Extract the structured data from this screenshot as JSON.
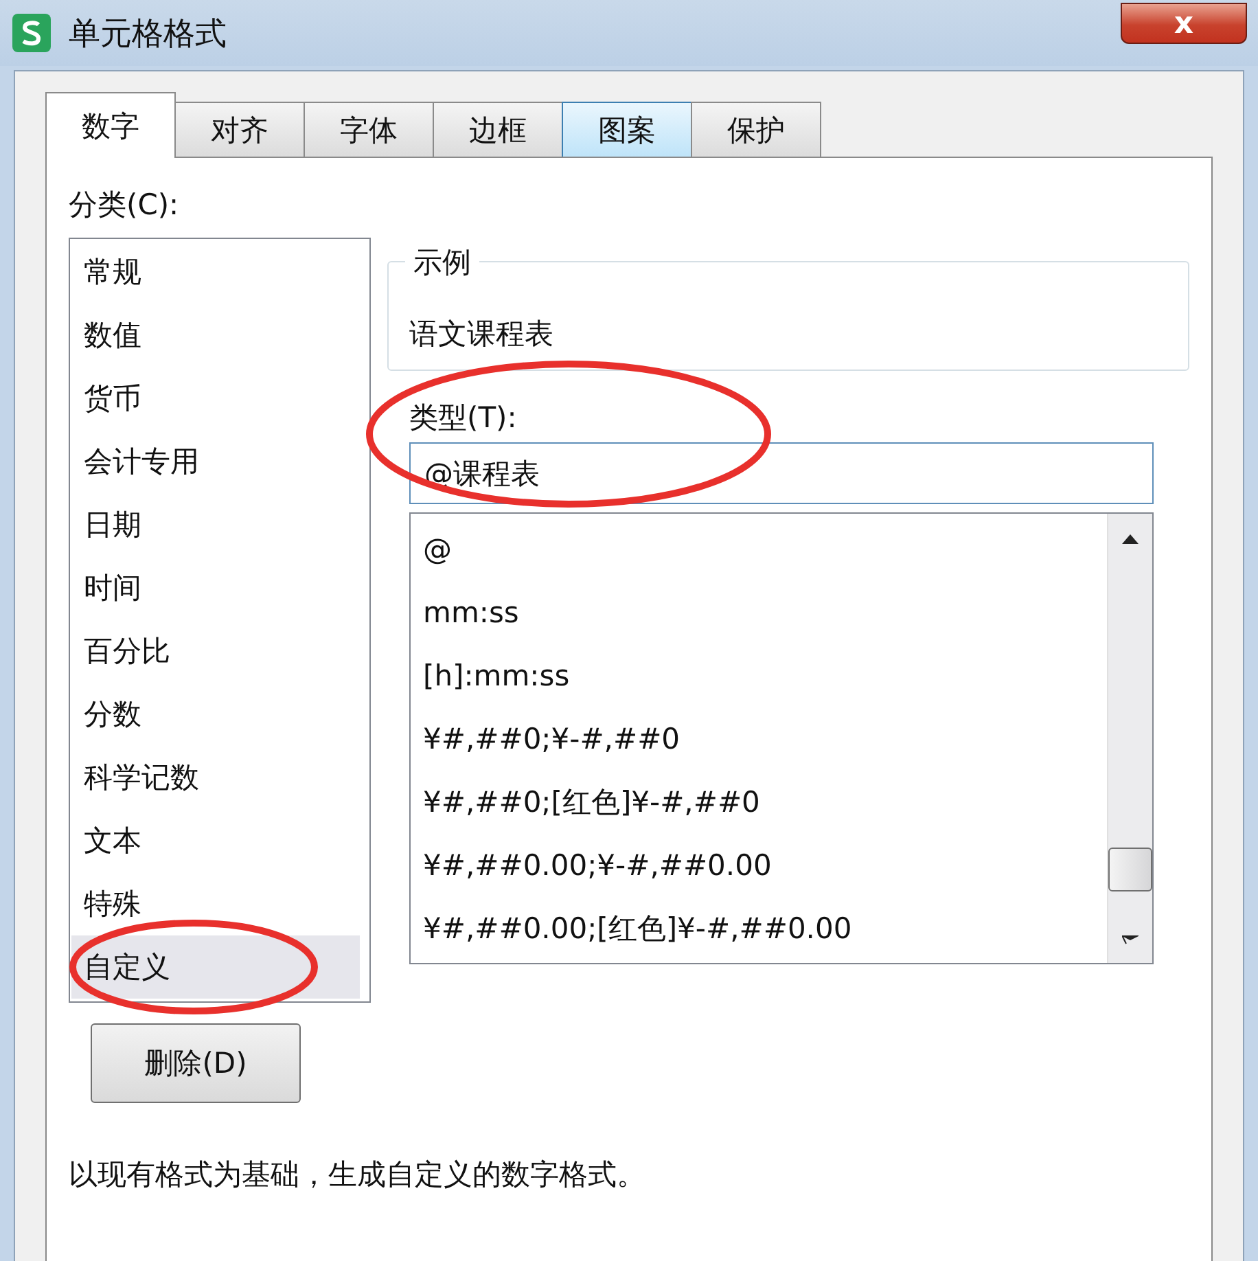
{
  "window": {
    "title": "单元格格式",
    "close": "x"
  },
  "tabs": [
    {
      "label": "数字",
      "selected": true,
      "hover": false
    },
    {
      "label": "对齐",
      "selected": false,
      "hover": false
    },
    {
      "label": "字体",
      "selected": false,
      "hover": false
    },
    {
      "label": "边框",
      "selected": false,
      "hover": false
    },
    {
      "label": "图案",
      "selected": false,
      "hover": true
    },
    {
      "label": "保护",
      "selected": false,
      "hover": false
    }
  ],
  "category": {
    "label": "分类(C):",
    "items": [
      {
        "label": "常规",
        "selected": false
      },
      {
        "label": "数值",
        "selected": false
      },
      {
        "label": "货币",
        "selected": false
      },
      {
        "label": "会计专用",
        "selected": false
      },
      {
        "label": "日期",
        "selected": false
      },
      {
        "label": "时间",
        "selected": false
      },
      {
        "label": "百分比",
        "selected": false
      },
      {
        "label": "分数",
        "selected": false
      },
      {
        "label": "科学记数",
        "selected": false
      },
      {
        "label": "文本",
        "selected": false
      },
      {
        "label": "特殊",
        "selected": false
      },
      {
        "label": "自定义",
        "selected": true,
        "circled": true
      }
    ]
  },
  "sample": {
    "label": "示例",
    "value": "语文课程表"
  },
  "type": {
    "label": "类型(T):",
    "value": "@课程表",
    "circled": true,
    "formats": [
      "@",
      "mm:ss",
      "[h]:mm:ss",
      "¥#,##0;¥-#,##0",
      "¥#,##0;[红色]¥-#,##0",
      "¥#,##0.00;¥-#,##0.00",
      "¥#,##0.00;[红色]¥-#,##0.00"
    ]
  },
  "delete_button": "删除(D)",
  "description": "以现有格式为基础，生成自定义的数字格式。"
}
